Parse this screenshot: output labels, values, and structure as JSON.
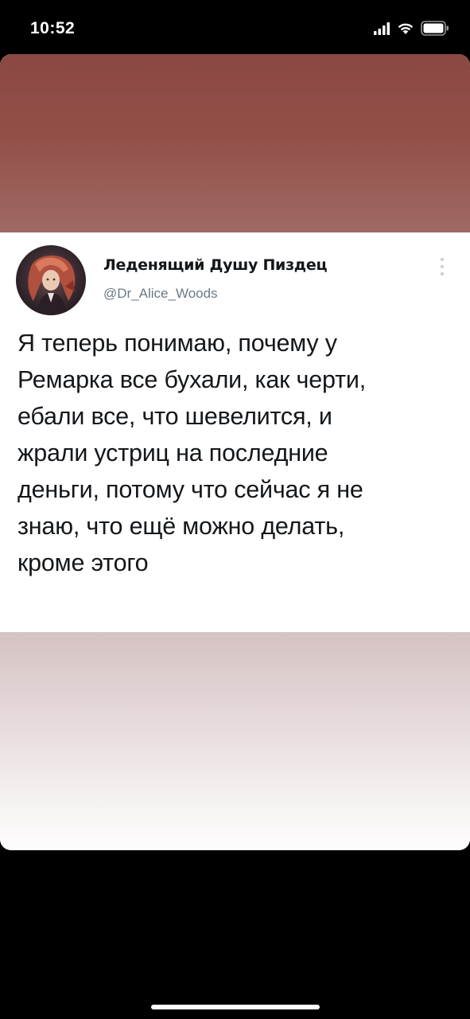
{
  "status_bar": {
    "time": "10:52"
  },
  "tweet": {
    "display_name": "Леденящий Душу Пиздец",
    "handle": "@Dr_Alice_Woods",
    "text": "Я теперь понимаю, почему у\nРемарка все бухали, как черти,\nебали все, что шевелится, и\nжрали устриц на последние\nденьги, потому что сейчас я не\nзнаю, что ещё можно делать,\nкроме этого"
  },
  "colors": {
    "top_band": "#8b4843",
    "bottom_band": "#d5c2c3",
    "text": "#14171a",
    "handle": "#6b7a87"
  },
  "icons": [
    "signal-icon",
    "wifi-icon",
    "battery-icon",
    "more-options-icon"
  ]
}
